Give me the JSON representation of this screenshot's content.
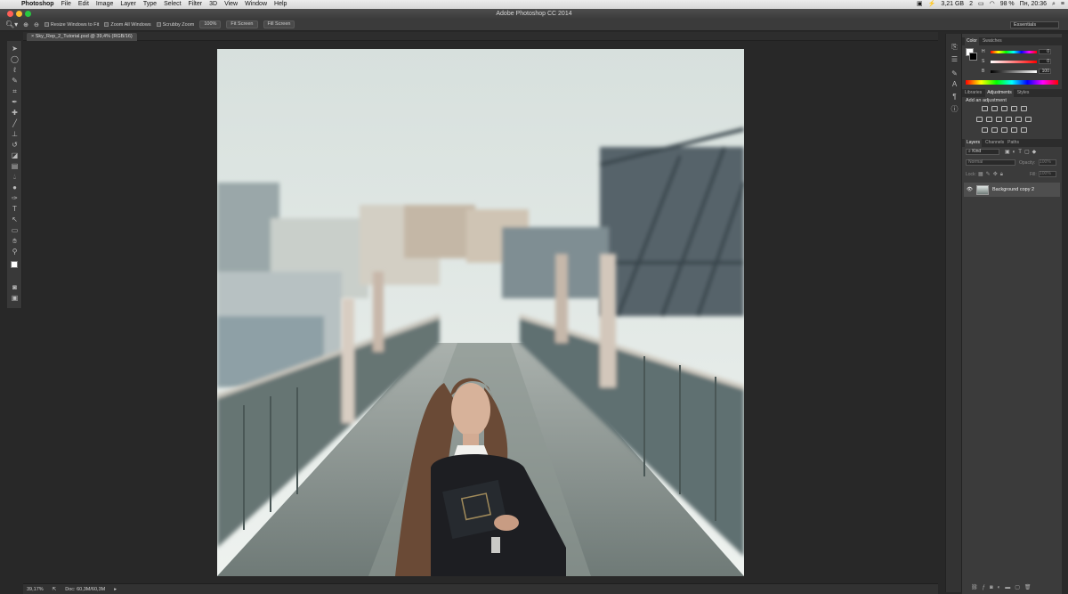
{
  "menubar": {
    "apple": "",
    "app_name": "Photoshop",
    "items": [
      "File",
      "Edit",
      "Image",
      "Layer",
      "Type",
      "Select",
      "Filter",
      "3D",
      "View",
      "Window",
      "Help"
    ],
    "memory": "3,21 GB",
    "counter": "2",
    "battery": "98 %",
    "clock": "Пн, 20:36"
  },
  "window": {
    "title": "Adobe Photoshop CC 2014"
  },
  "options_bar": {
    "resize_windows": "Resize Windows to Fit",
    "zoom_all": "Zoom All Windows",
    "scrubby_zoom": "Scrubby Zoom",
    "btn_100": "100%",
    "btn_fit": "Fit Screen",
    "btn_fill": "Fill Screen",
    "workspace": "Essentials"
  },
  "document": {
    "tab_title": "Sky_Rep_2_Tutorial.psd @ 39,4% (RGB/16)"
  },
  "status": {
    "zoom": "39,17%",
    "doc_size": "Doc: 60,3M/60,3M"
  },
  "color_panel": {
    "tabs": [
      "Color",
      "Swatches"
    ],
    "labels": [
      "H",
      "S",
      "B"
    ],
    "values": [
      "0",
      "0",
      "100"
    ]
  },
  "adjustments_panel": {
    "tabs": [
      "Libraries",
      "Adjustments",
      "Styles"
    ],
    "heading": "Add an adjustment"
  },
  "layers_panel": {
    "tabs": [
      "Layers",
      "Channels",
      "Paths"
    ],
    "filter": "Kind",
    "blend_mode": "Normal",
    "opacity_label": "Opacity:",
    "opacity_value": "100%",
    "lock_label": "Lock:",
    "fill_label": "Fill:",
    "fill_value": "100%",
    "layers": [
      {
        "name": "Background copy 2",
        "visible": true
      }
    ]
  },
  "colors": {
    "menubar": "#e0e0e0",
    "workspace": "#282828",
    "panel": "#3b3b3b",
    "accent_red": "#ff5f57",
    "accent_yellow": "#febc2e",
    "accent_green": "#28c840"
  }
}
